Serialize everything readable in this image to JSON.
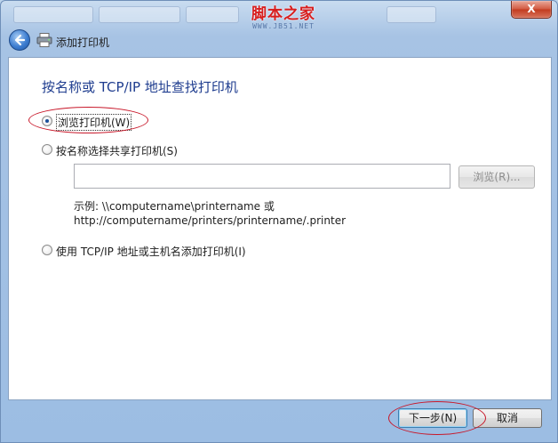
{
  "window": {
    "close_label": "X"
  },
  "watermark": {
    "main": "脚本之家",
    "sub": "WWW.JB51.NET"
  },
  "wizard": {
    "title": "添加打印机",
    "heading": "按名称或 TCP/IP 地址查找打印机"
  },
  "options": [
    {
      "label": "浏览打印机(W)",
      "selected": true
    },
    {
      "label": "按名称选择共享打印机(S)",
      "selected": false
    },
    {
      "label": "使用 TCP/IP 地址或主机名添加打印机(I)",
      "selected": false
    }
  ],
  "shared_printer": {
    "input_value": "",
    "browse_label": "浏览(R)...",
    "example_line1": "示例: \\\\computername\\printername 或",
    "example_line2": "http://computername/printers/printername/.printer"
  },
  "buttons": {
    "next": "下一步(N)",
    "cancel": "取消"
  },
  "colors": {
    "heading": "#1f3d8f",
    "annotation": "#c8182a",
    "frame": "#a7c3e4"
  }
}
